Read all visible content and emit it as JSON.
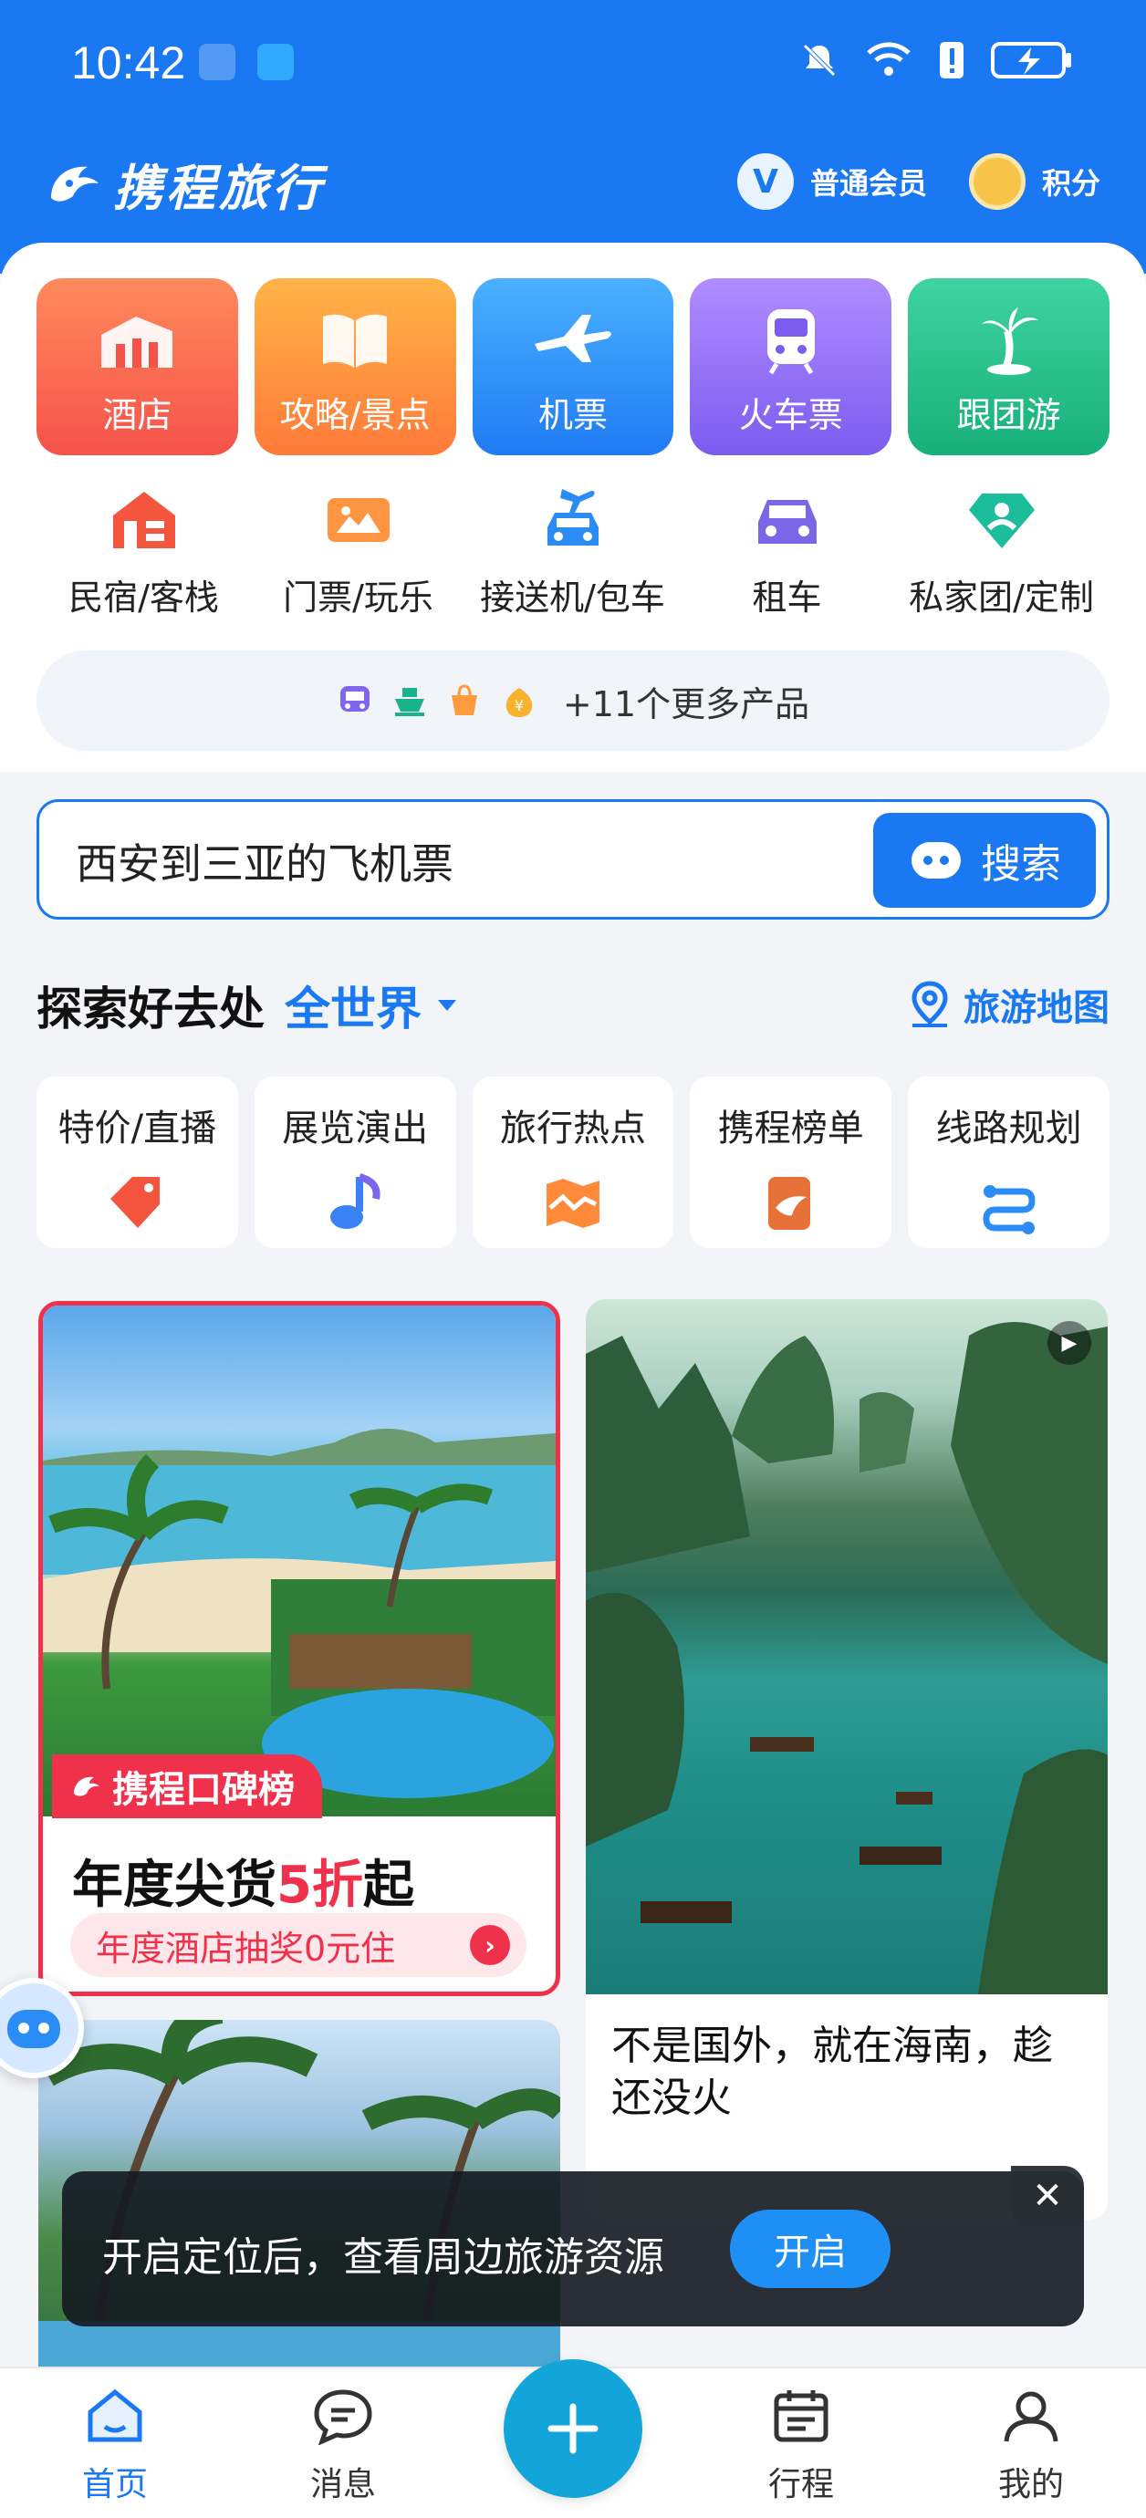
{
  "status_bar": {
    "time": "10:42"
  },
  "brand": {
    "name": "携程旅行"
  },
  "member": {
    "label": "普通会员",
    "badge": "V"
  },
  "points": {
    "label": "积分"
  },
  "main_tiles": [
    {
      "label": "酒店",
      "color": "#f6524a"
    },
    {
      "label": "攻略/景点",
      "color": "#ff7a3a"
    },
    {
      "label": "机票",
      "color": "#1f7bf3"
    },
    {
      "label": "火车票",
      "color": "#7b5cf0"
    },
    {
      "label": "跟团游",
      "color": "#18b07a"
    }
  ],
  "sub_items": [
    {
      "label": "民宿/客栈",
      "icon": "homestay-icon"
    },
    {
      "label": "门票/玩乐",
      "icon": "ticket-icon"
    },
    {
      "label": "接送机/包车",
      "icon": "car-transfer-icon"
    },
    {
      "label": "租车",
      "icon": "car-rental-icon"
    },
    {
      "label": "私家团/定制",
      "icon": "custom-tour-icon"
    }
  ],
  "more_products": {
    "text": "+11个更多产品"
  },
  "search": {
    "value": "西安到三亚的飞机票",
    "button_label": "搜索"
  },
  "explore": {
    "title": "探索好去处",
    "region": "全世界",
    "map_link": "旅游地图"
  },
  "categories": [
    {
      "label": "特价/直播",
      "icon": "price-tag-icon"
    },
    {
      "label": "展览演出",
      "icon": "music-note-icon"
    },
    {
      "label": "旅行热点",
      "icon": "hot-map-icon"
    },
    {
      "label": "携程榜单",
      "icon": "ranking-icon"
    },
    {
      "label": "线路规划",
      "icon": "route-icon"
    }
  ],
  "feed": {
    "left_card": {
      "tag": "携程口碑榜",
      "headline_prefix": "年度尖货",
      "headline_highlight": "5折",
      "headline_suffix": "起",
      "pill": "年度酒店抽奖0元住"
    },
    "right_card": {
      "title": "不是国外，就在海南，趁还没火"
    }
  },
  "toast": {
    "text": "开启定位后，查看周边旅游资源",
    "button": "开启"
  },
  "bottom_nav": [
    {
      "label": "首页",
      "icon": "home-icon",
      "active": true
    },
    {
      "label": "消息",
      "icon": "message-icon",
      "active": false
    },
    {
      "label": "行程",
      "icon": "calendar-icon",
      "active": false
    },
    {
      "label": "我的",
      "icon": "profile-icon",
      "active": false
    }
  ],
  "colors": {
    "brand_blue": "#1a78f2",
    "accent_red": "#f0314b"
  }
}
